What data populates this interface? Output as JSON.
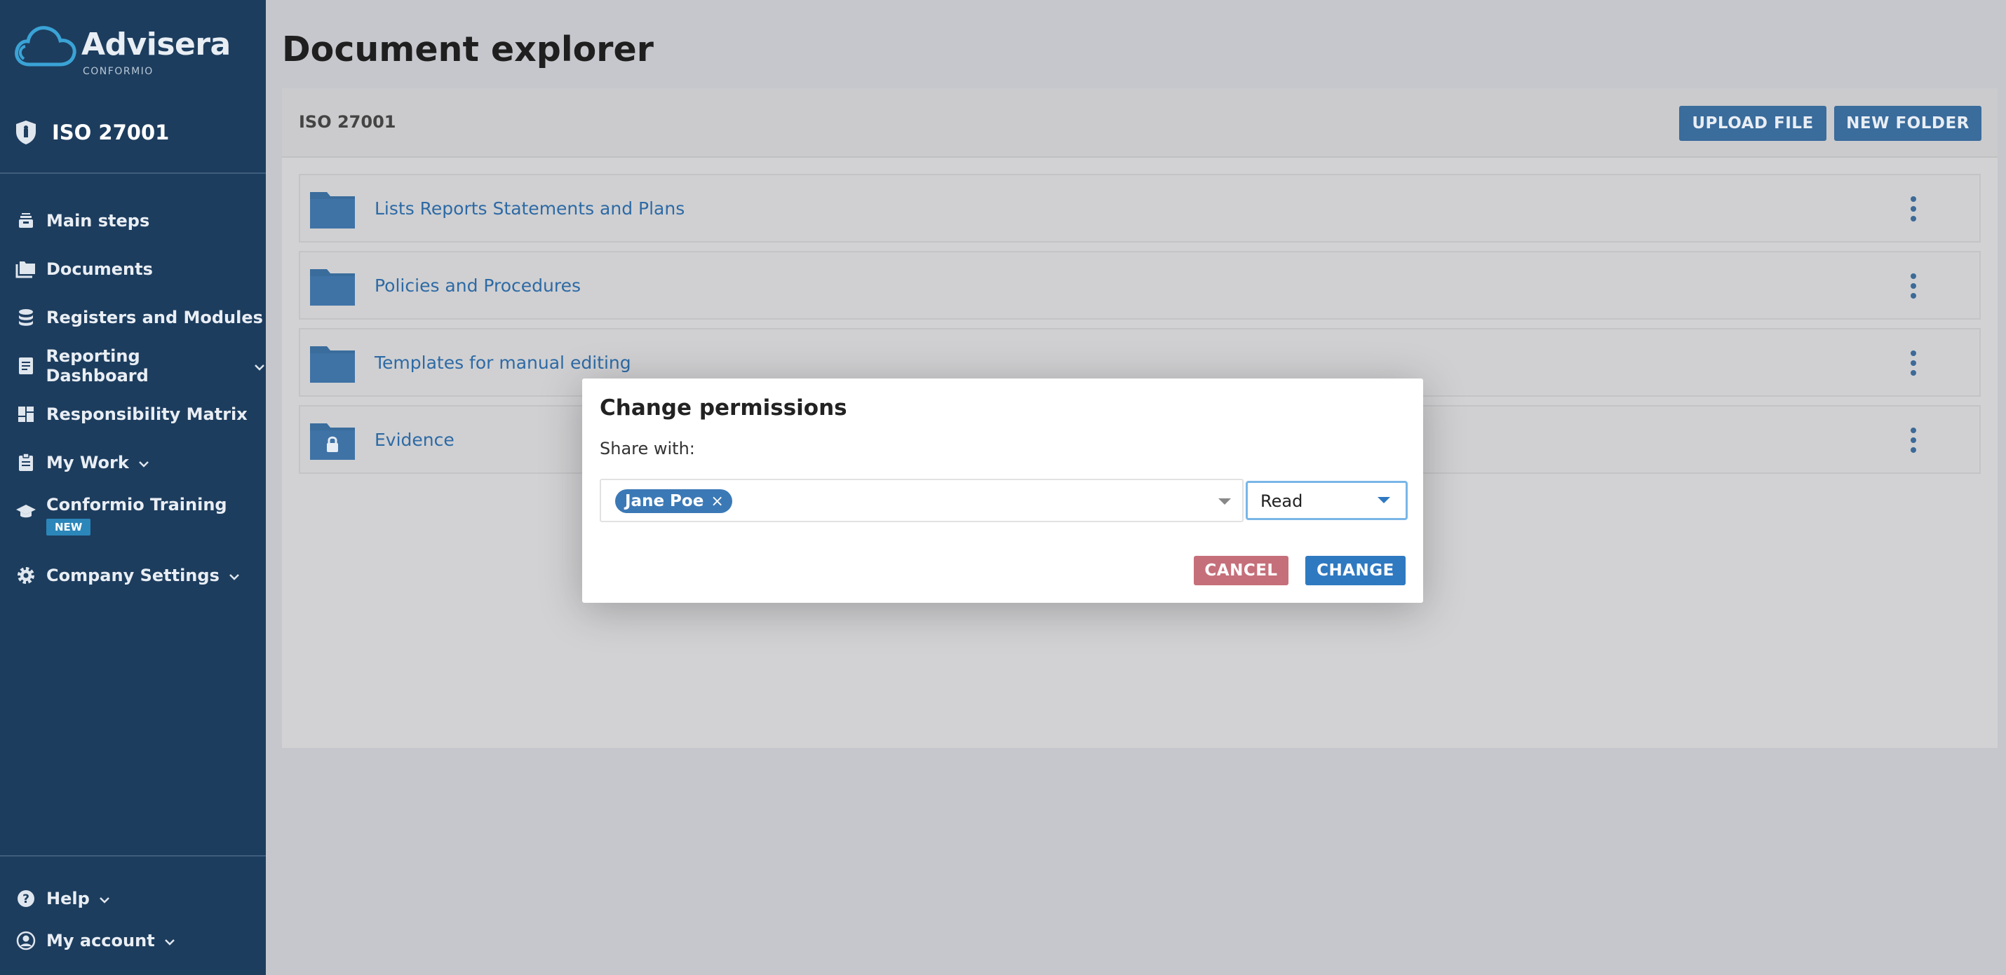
{
  "app": {
    "brand": "Advisera",
    "brand_sub": "CONFORMIO"
  },
  "sidebar": {
    "product": "ISO 27001",
    "items": [
      {
        "label": "Main steps",
        "icon": "inbox-stack-icon"
      },
      {
        "label": "Documents",
        "icon": "folders-icon"
      },
      {
        "label": "Registers and Modules",
        "icon": "database-icon"
      },
      {
        "label": "Reporting Dashboard",
        "icon": "report-icon",
        "expandable": true
      },
      {
        "label": "Responsibility Matrix",
        "icon": "dashboard-grid-icon"
      },
      {
        "label": "My Work",
        "icon": "clipboard-icon",
        "expandable": true
      },
      {
        "label": "Conformio Training",
        "icon": "graduation-cap-icon",
        "badge": "NEW"
      },
      {
        "label": "Company Settings",
        "icon": "gear-icon",
        "expandable": true
      }
    ],
    "bottom": [
      {
        "label": "Help",
        "icon": "question-circle-icon",
        "expandable": true
      },
      {
        "label": "My account",
        "icon": "user-circle-icon",
        "expandable": true
      }
    ]
  },
  "main": {
    "title": "Document explorer",
    "breadcrumb": "ISO 27001",
    "upload_label": "UPLOAD FILE",
    "new_folder_label": "NEW FOLDER",
    "folders": [
      {
        "name": "Lists Reports Statements and Plans",
        "locked": false
      },
      {
        "name": "Policies and Procedures",
        "locked": false
      },
      {
        "name": "Templates for manual editing",
        "locked": false
      },
      {
        "name": "Evidence",
        "locked": true
      }
    ]
  },
  "modal": {
    "title": "Change permissions",
    "share_label": "Share with:",
    "selected_user": "Jane Poe",
    "permission": "Read",
    "cancel_label": "CANCEL",
    "change_label": "CHANGE"
  },
  "colors": {
    "sidebar": "#1d3d5e",
    "accent": "#3a6c9c",
    "link": "#2d6aa5",
    "cancel": "#c56f7a",
    "change": "#2f79c1"
  }
}
